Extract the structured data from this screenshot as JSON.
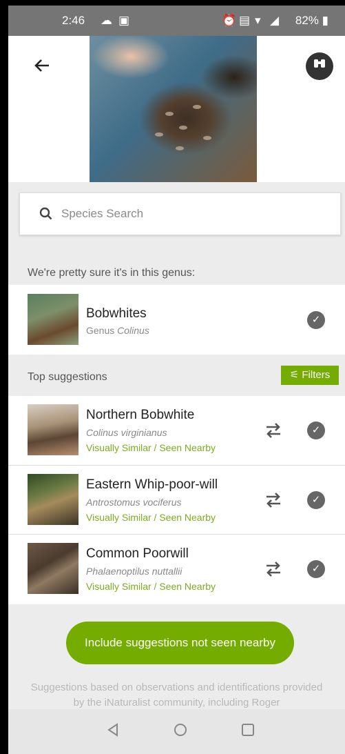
{
  "status_bar": {
    "time": "2:46",
    "battery": "82%"
  },
  "header": {
    "back_label": "←"
  },
  "search": {
    "placeholder": "Species Search"
  },
  "genus_section": {
    "label": "We're pretty sure it's in this genus:",
    "item": {
      "name": "Bobwhites",
      "rank": "Genus",
      "scientific": "Colinus"
    }
  },
  "suggestions_section": {
    "label": "Top suggestions",
    "filters_label": "Filters",
    "items": [
      {
        "name": "Northern Bobwhite",
        "scientific": "Colinus virginianus",
        "reason": "Visually Similar / Seen Nearby"
      },
      {
        "name": "Eastern Whip-poor-will",
        "scientific": "Antrostomus vociferus",
        "reason": "Visually Similar / Seen Nearby"
      },
      {
        "name": "Common Poorwill",
        "scientific": "Phalaenoptilus nuttallii",
        "reason": "Visually Similar / Seen Nearby"
      }
    ]
  },
  "cta_label": "Include suggestions not seen nearby",
  "footer_text": "Suggestions based on observations and identifications provided by the iNaturalist community, including Roger",
  "colors": {
    "accent": "#74ac00",
    "reason_text": "#7cab1e",
    "status_bar": "#757575"
  },
  "icons": [
    "alarm-icon",
    "cloud-icon",
    "image-icon",
    "sim-icon",
    "wifi-icon",
    "signal-icon",
    "battery-icon",
    "back-arrow-icon",
    "binoculars-icon",
    "search-icon",
    "check-icon",
    "compare-icon",
    "filter-icon",
    "nav-back-icon",
    "nav-home-icon",
    "nav-recents-icon"
  ]
}
